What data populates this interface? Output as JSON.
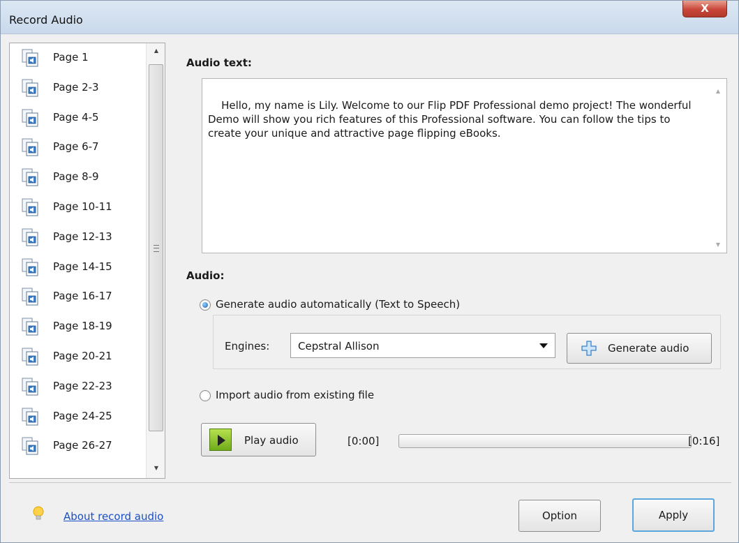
{
  "window": {
    "title": "Record Audio",
    "close_label": "X"
  },
  "page_list": {
    "items": [
      {
        "label": "Page 1"
      },
      {
        "label": "Page 2-3"
      },
      {
        "label": "Page 4-5"
      },
      {
        "label": "Page 6-7"
      },
      {
        "label": "Page 8-9"
      },
      {
        "label": "Page 10-11"
      },
      {
        "label": "Page 12-13"
      },
      {
        "label": "Page 14-15"
      },
      {
        "label": "Page 16-17"
      },
      {
        "label": "Page 18-19"
      },
      {
        "label": "Page 20-21"
      },
      {
        "label": "Page 22-23"
      },
      {
        "label": "Page 24-25"
      },
      {
        "label": "Page 26-27"
      }
    ],
    "item_icon": "audio-page-icon",
    "selected_index": 0
  },
  "audio_text": {
    "label": "Audio text:",
    "value": "Hello, my name is Lily. Welcome to our Flip PDF Professional demo project! The wonderful Demo will show you rich features of this Professional software. You can follow the tips to create your unique and attractive page flipping eBooks."
  },
  "audio": {
    "label": "Audio:",
    "generate_option_label": "Generate audio automatically (Text to Speech)",
    "generate_selected": true,
    "engines_label": "Engines:",
    "engine_value": "Cepstral Allison",
    "generate_button_label": "Generate audio",
    "import_option_label": "Import audio from existing file",
    "import_selected": false,
    "play_button_label": "Play audio",
    "time_start": "[0:00]",
    "time_end": "[0:16]",
    "progress": 0
  },
  "footer": {
    "about_link": "About record audio",
    "option_button_label": "Option",
    "apply_button_label": "Apply"
  },
  "colors": {
    "link": "#1a4ec7",
    "play_green": "#8cc63f",
    "accent_blue": "#5aa7dd"
  }
}
